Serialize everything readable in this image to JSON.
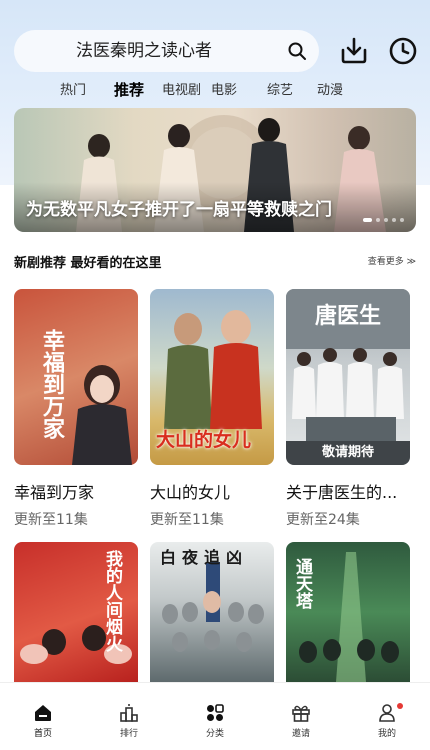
{
  "search": {
    "query": "法医秦明之读心者"
  },
  "tabs": [
    {
      "label": "热门"
    },
    {
      "label": "推荐"
    },
    {
      "label": "电视剧"
    },
    {
      "label": "电影"
    },
    {
      "label": "综艺"
    },
    {
      "label": "动漫"
    }
  ],
  "banner": {
    "title": "为无数平凡女子推开了一扇平等救赎之门",
    "page_count": 5,
    "current_page": 1
  },
  "section": {
    "title": "新剧推荐  最好看的在这里",
    "more": "查看更多 ≫"
  },
  "cards": [
    {
      "title": "幸福到万家",
      "subtitle": "更新至11集",
      "poster_text": "幸福到万家"
    },
    {
      "title": "大山的女儿",
      "subtitle": "更新至11集",
      "poster_text": "大山的女儿"
    },
    {
      "title": "关于唐医生的...",
      "subtitle": "更新至24集",
      "poster_text": "敬请期待"
    },
    {
      "title": "",
      "subtitle": "",
      "poster_text": "我的人间烟火"
    },
    {
      "title": "",
      "subtitle": "",
      "poster_text": "白夜追凶"
    },
    {
      "title": "",
      "subtitle": "",
      "poster_text": "通天塔"
    }
  ],
  "nav": [
    {
      "label": "首页",
      "icon": "home-icon"
    },
    {
      "label": "排行",
      "icon": "ranking-icon"
    },
    {
      "label": "分类",
      "icon": "category-icon"
    },
    {
      "label": "邀请",
      "icon": "gift-icon"
    },
    {
      "label": "我的",
      "icon": "profile-icon"
    }
  ],
  "colors": {
    "accent": "#000000",
    "background_top": "#d6e6f8",
    "badge": "#e53935"
  }
}
